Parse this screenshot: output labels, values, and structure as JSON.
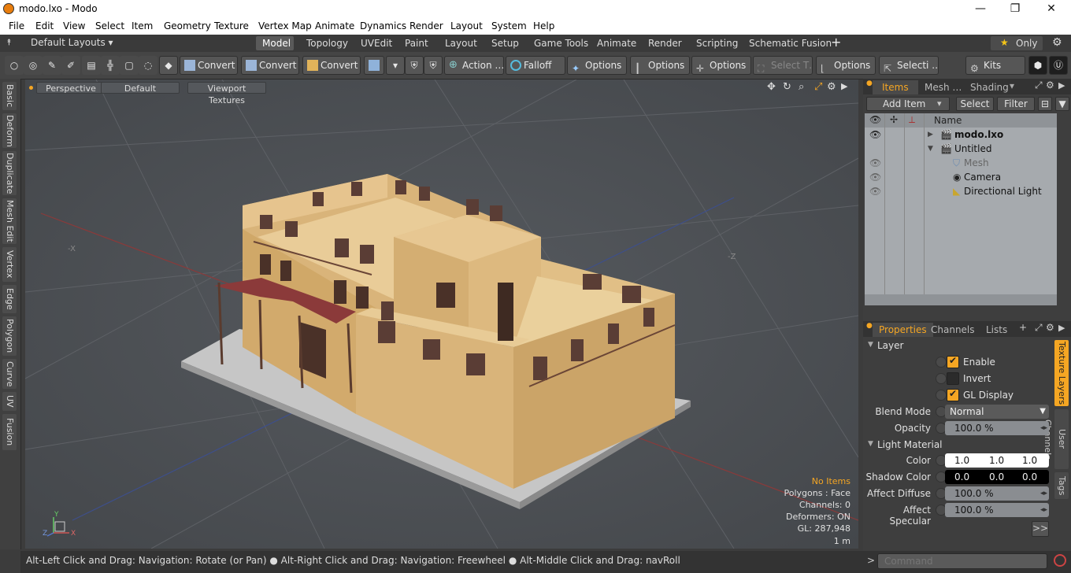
{
  "window": {
    "title": "modo.lxo - Modo",
    "minimize": "—",
    "maximize": "❐",
    "close": "✕"
  },
  "menu": [
    "File",
    "Edit",
    "View",
    "Select",
    "Item",
    "Geometry",
    "Texture",
    "Vertex Map",
    "Animate",
    "Dynamics",
    "Render",
    "Layout",
    "System",
    "Help"
  ],
  "layouts": {
    "selector": "Default Layouts ▾",
    "tabs": [
      "Model",
      "Topology",
      "UVEdit",
      "Paint",
      "Layout",
      "Setup",
      "Game Tools",
      "Animate",
      "Render",
      "Scripting",
      "Schematic Fusion"
    ],
    "active": "Model",
    "add": "+",
    "only": "Only"
  },
  "toolbar": {
    "convert1": "Convert",
    "convert2": "Convert",
    "convert3": "Convert",
    "action": "Action …",
    "falloff": "Falloff",
    "options1": "Options",
    "options2": "Options",
    "options3": "Options",
    "select_t": "Select T…",
    "options4": "Options",
    "selecti": "Selecti …",
    "kits": "Kits"
  },
  "left_tabs": [
    "Basic",
    "Deform",
    "Duplicate",
    "Mesh Edit",
    "Vertex",
    "Edge",
    "Polygon",
    "Curve",
    "UV",
    "Fusion"
  ],
  "viewport": {
    "view": "Perspective",
    "shading": "Default",
    "textures": "Viewport Textures",
    "axis_x": "-X",
    "axis_z": "-Z",
    "info": {
      "no_items": "No Items",
      "polygons": "Polygons : Face",
      "channels": "Channels: 0",
      "deformers": "Deformers: ON",
      "gl": "GL: 287,948",
      "scale": "1 m"
    },
    "gizmo": {
      "y": "Y",
      "z": "Z",
      "x": "X"
    }
  },
  "status": {
    "text": "Alt-Left Click and Drag: Navigation: Rotate (or Pan) ● Alt-Right Click and Drag: Navigation: Freewheel ● Alt-Middle Click and Drag: navRoll"
  },
  "items_panel": {
    "tabs": [
      "Items",
      "Mesh …",
      "Shading"
    ],
    "add_item": "Add Item",
    "select": "Select",
    "filter": "Filter",
    "name_header": "Name",
    "rows": [
      {
        "label": "modo.lxo"
      },
      {
        "label": "Untitled"
      },
      {
        "label": "Mesh"
      },
      {
        "label": "Camera"
      },
      {
        "label": "Directional Light"
      }
    ]
  },
  "properties_panel": {
    "tabs": [
      "Properties",
      "Channels",
      "Lists"
    ],
    "side_tabs": [
      "Texture Layers",
      "User Channels",
      "Tags"
    ],
    "layer_section": "Layer",
    "enable": "Enable",
    "invert": "Invert",
    "gl_display": "GL Display",
    "blend_mode_label": "Blend Mode",
    "blend_mode": "Normal",
    "opacity_label": "Opacity",
    "opacity": "100.0 %",
    "light_material": "Light Material",
    "color_label": "Color",
    "color": [
      "1.0",
      "1.0",
      "1.0"
    ],
    "shadow_color_label": "Shadow Color",
    "shadow_color": [
      "0.0",
      "0.0",
      "0.0"
    ],
    "affect_diffuse_label": "Affect Diffuse",
    "affect_diffuse": "100.0 %",
    "affect_specular_label": "Affect Specular",
    "affect_specular": "100.0 %",
    "more": ">>"
  },
  "command": {
    "placeholder": "Command",
    "prompt": ">"
  },
  "colors": {
    "accent": "#f5a623",
    "viewport": "#4b4e52",
    "panel": "#3e3e3e"
  }
}
